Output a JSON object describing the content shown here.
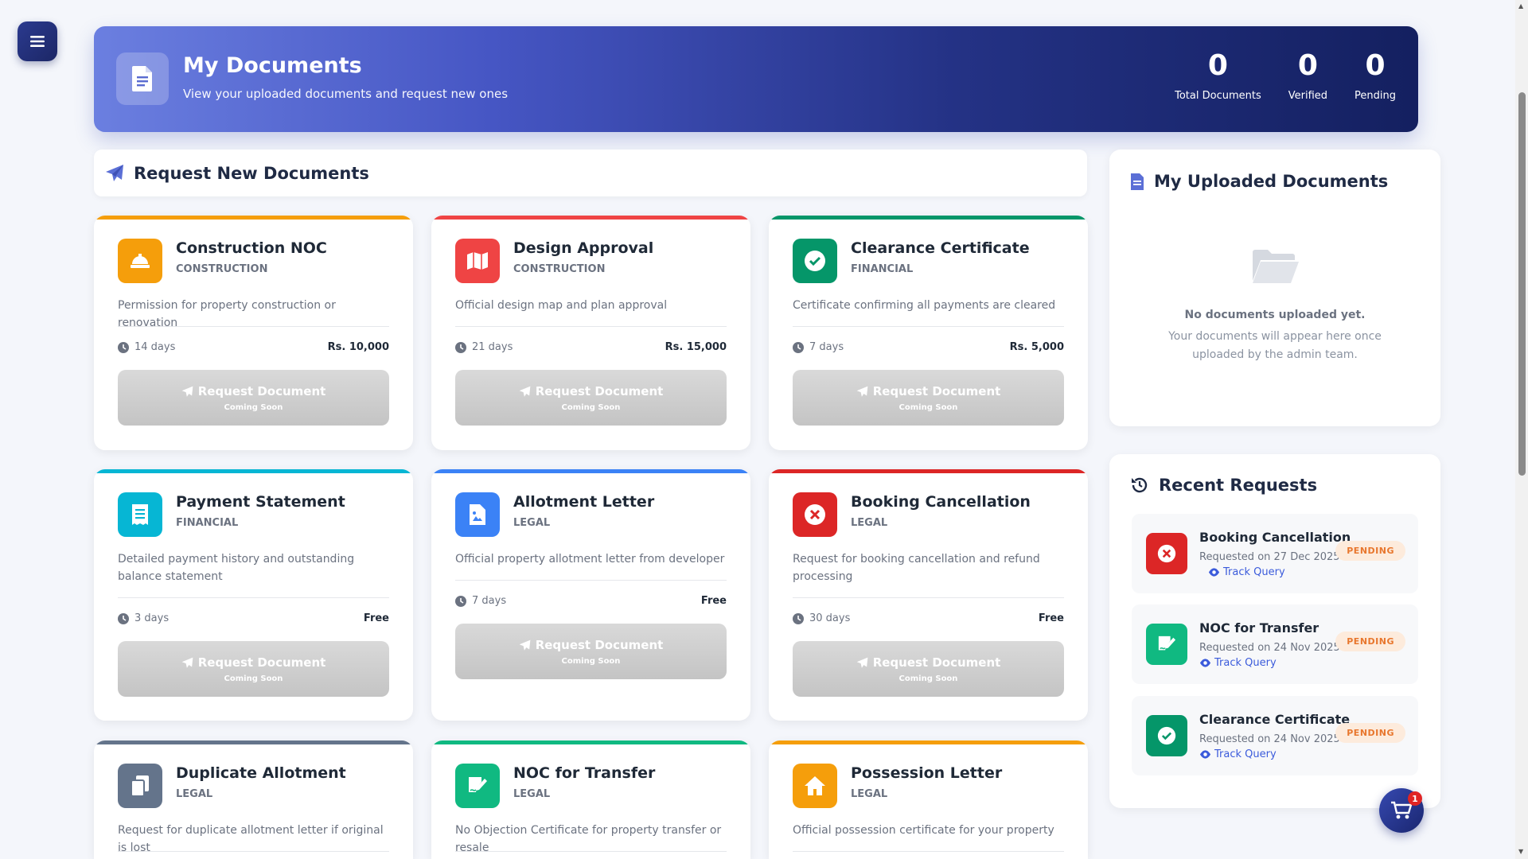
{
  "header": {
    "title": "My Documents",
    "subtitle": "View your uploaded documents and request new ones",
    "stats": [
      {
        "value": "0",
        "label": "Total Documents"
      },
      {
        "value": "0",
        "label": "Verified"
      },
      {
        "value": "0",
        "label": "Pending"
      }
    ]
  },
  "request_section": {
    "title": "Request New Documents"
  },
  "cards": [
    {
      "title": "Construction NOC",
      "category": "CONSTRUCTION",
      "description": "Permission for property construction or renovation",
      "days": "14 days",
      "price": "Rs. 10,000",
      "button": "Request Document",
      "button_sub": "Coming Soon",
      "color": "#f59e0b",
      "icon": "helmet-icon"
    },
    {
      "title": "Design Approval",
      "category": "CONSTRUCTION",
      "description": "Official design map and plan approval",
      "days": "21 days",
      "price": "Rs. 15,000",
      "button": "Request Document",
      "button_sub": "Coming Soon",
      "color": "#ef4444",
      "icon": "map-icon"
    },
    {
      "title": "Clearance Certificate",
      "category": "FINANCIAL",
      "description": "Certificate confirming all payments are cleared",
      "days": "7 days",
      "price": "Rs. 5,000",
      "button": "Request Document",
      "button_sub": "Coming Soon",
      "color": "#059669",
      "icon": "check-circle-icon"
    },
    {
      "title": "Payment Statement",
      "category": "FINANCIAL",
      "description": "Detailed payment history and outstanding balance statement",
      "days": "3 days",
      "price": "Free",
      "button": "Request Document",
      "button_sub": "Coming Soon",
      "color": "#06b6d4",
      "icon": "receipt-icon"
    },
    {
      "title": "Allotment Letter",
      "category": "LEGAL",
      "description": "Official property allotment letter from developer",
      "days": "7 days",
      "price": "Free",
      "button": "Request Document",
      "button_sub": "Coming Soon",
      "color": "#3b82f6",
      "icon": "document-image-icon"
    },
    {
      "title": "Booking Cancellation",
      "category": "LEGAL",
      "description": "Request for booking cancellation and refund processing",
      "days": "30 days",
      "price": "Free",
      "button": "Request Document",
      "button_sub": "Coming Soon",
      "color": "#dc2626",
      "icon": "x-circle-icon"
    },
    {
      "title": "Duplicate Allotment",
      "category": "LEGAL",
      "description": "Request for duplicate allotment letter if original is lost",
      "color": "#64748b",
      "icon": "copy-icon"
    },
    {
      "title": "NOC for Transfer",
      "category": "LEGAL",
      "description": "No Objection Certificate for property transfer or resale",
      "color": "#10b981",
      "icon": "signature-icon"
    },
    {
      "title": "Possession Letter",
      "category": "LEGAL",
      "description": "Official possession certificate for your property",
      "color": "#f59e0b",
      "icon": "home-icon"
    }
  ],
  "uploaded": {
    "title": "My Uploaded Documents",
    "empty_title": "No documents uploaded yet.",
    "empty_line1": "Your documents will appear here once",
    "empty_line2": "uploaded by the admin team."
  },
  "recent": {
    "title": "Recent Requests",
    "items": [
      {
        "title": "Booking Cancellation",
        "date": "Requested on 27 Dec 2025",
        "track": "Track Query",
        "status": "PENDING",
        "color": "#dc2626",
        "icon": "x-circle-icon"
      },
      {
        "title": "NOC for Transfer",
        "date": "Requested on 24 Nov 2025",
        "track": "Track Query",
        "status": "PENDING",
        "color": "#10b981",
        "icon": "signature-icon"
      },
      {
        "title": "Clearance Certificate",
        "date": "Requested on 24 Nov 2025",
        "track": "Track Query",
        "status": "PENDING",
        "color": "#059669",
        "icon": "check-circle-icon"
      }
    ]
  },
  "cart": {
    "count": "1"
  }
}
